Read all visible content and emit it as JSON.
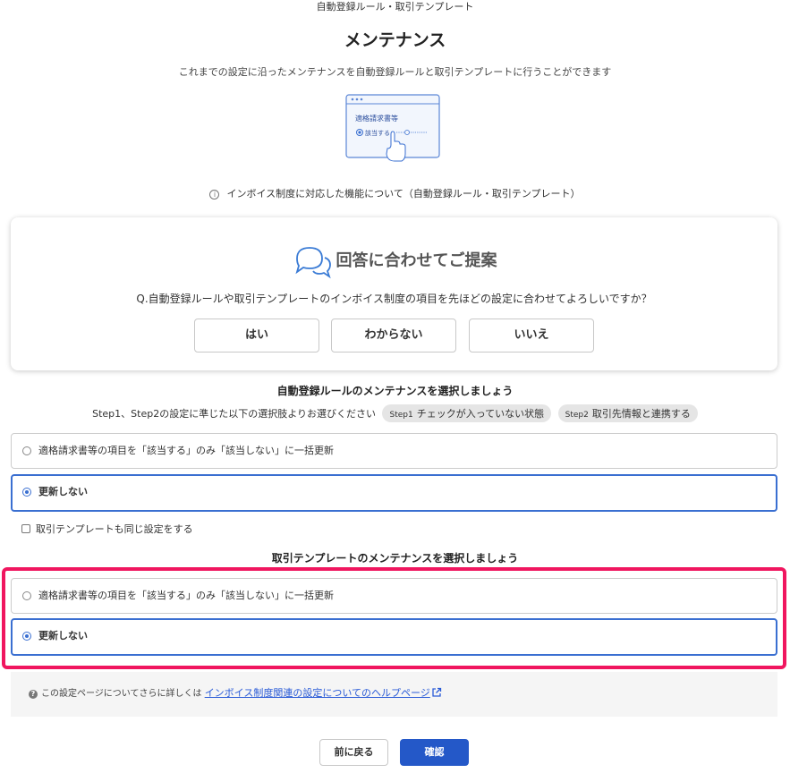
{
  "breadcrumb": "自動登録ルール・取引テンプレート",
  "page_title": "メンテナンス",
  "subtitle": "これまでの設定に沿ったメンテナンスを自動登録ルールと取引テンプレートに行うことができます",
  "illustration": {
    "title": "適格請求書等",
    "option_label": "該当する"
  },
  "info_link": {
    "icon": "info-icon",
    "text": "インボイス制度に対応した機能について（自動登録ルール・取引テンプレート）"
  },
  "suggest": {
    "icon": "chat-bubbles-icon",
    "title": "回答に合わせてご提案",
    "question": "Q.自動登録ルールや取引テンプレートのインボイス制度の項目を先ほどの設定に合わせてよろしいですか？",
    "buttons": [
      "はい",
      "わからない",
      "いいえ"
    ]
  },
  "auto_rule": {
    "title": "自動登録ルールのメンテナンスを選択しましょう",
    "step_text": "Step1、Step2の設定に準じた以下の選択肢よりお選びください",
    "chips": [
      {
        "step": "Step1",
        "label": "チェックが入っていない状態"
      },
      {
        "step": "Step2",
        "label": "取引先情報と連携する"
      }
    ],
    "options": [
      {
        "label": "適格請求書等の項目を「該当する」のみ「該当しない」に一括更新",
        "selected": false
      },
      {
        "label": "更新しない",
        "selected": true
      }
    ],
    "same_setting_checkbox": "取引テンプレートも同じ設定をする"
  },
  "template": {
    "title": "取引テンプレートのメンテナンスを選択しましょう",
    "options": [
      {
        "label": "適格請求書等の項目を「該当する」のみ「該当しない」に一括更新",
        "selected": false
      },
      {
        "label": "更新しない",
        "selected": true
      }
    ]
  },
  "help": {
    "icon": "question-icon",
    "prefix": "この設定ページについてさらに詳しくは",
    "link": "インボイス制度関連の設定についてのヘルプページ",
    "link_icon": "external-link-icon"
  },
  "footer": {
    "back_label": "前に戻る",
    "confirm_label": "確認"
  },
  "colors": {
    "primary": "#2458c8",
    "selected_border": "#3a6fd1",
    "highlight": "#f0165f"
  }
}
